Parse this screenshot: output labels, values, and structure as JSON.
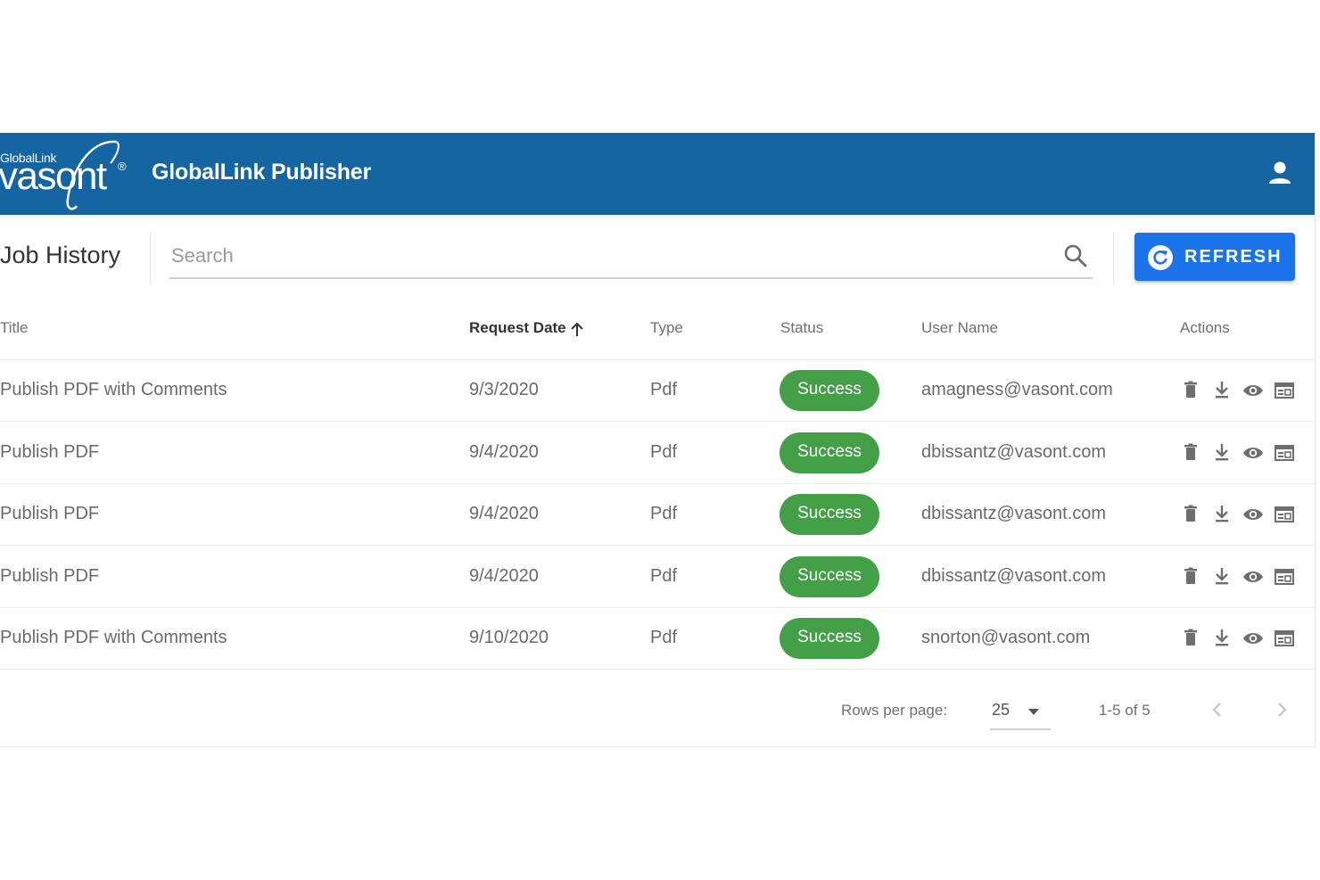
{
  "header": {
    "logo_small": "GlobalLink",
    "logo_main": "vasont",
    "logo_reg": "®",
    "app_title": "GlobalLink Publisher",
    "user_icon": "account-icon",
    "background_color": "#1565a3"
  },
  "toolbar": {
    "page_title": "Job History",
    "search_placeholder": "Search",
    "search_value": "",
    "search_icon": "search-icon",
    "refresh_label": "REFRESH",
    "refresh_icon": "refresh-icon",
    "refresh_color": "#1a73e8"
  },
  "table": {
    "columns": [
      "Title",
      "Request Date",
      "Type",
      "Status",
      "User Name",
      "Actions"
    ],
    "sorted_column": "Request Date",
    "sort_direction": "ascending",
    "rows": [
      {
        "title": "Publish PDF with Comments",
        "date": "9/3/2020",
        "type": "Pdf",
        "status": "Success",
        "user": "amagness@vasont.com"
      },
      {
        "title": "Publish PDF",
        "date": "9/4/2020",
        "type": "Pdf",
        "status": "Success",
        "user": "dbissantz@vasont.com"
      },
      {
        "title": "Publish PDF",
        "date": "9/4/2020",
        "type": "Pdf",
        "status": "Success",
        "user": "dbissantz@vasont.com"
      },
      {
        "title": "Publish PDF",
        "date": "9/4/2020",
        "type": "Pdf",
        "status": "Success",
        "user": "dbissantz@vasont.com"
      },
      {
        "title": "Publish PDF with Comments",
        "date": "9/10/2020",
        "type": "Pdf",
        "status": "Success",
        "user": "snorton@vasont.com"
      }
    ],
    "row_actions": [
      "delete-icon",
      "download-icon",
      "view-icon",
      "details-icon"
    ],
    "status_color": "#43a047"
  },
  "pagination": {
    "rows_per_page_label": "Rows per page:",
    "rows_per_page_value": "25",
    "range_text": "1-5 of 5",
    "prev_icon": "chevron-left-icon",
    "next_icon": "chevron-right-icon"
  }
}
